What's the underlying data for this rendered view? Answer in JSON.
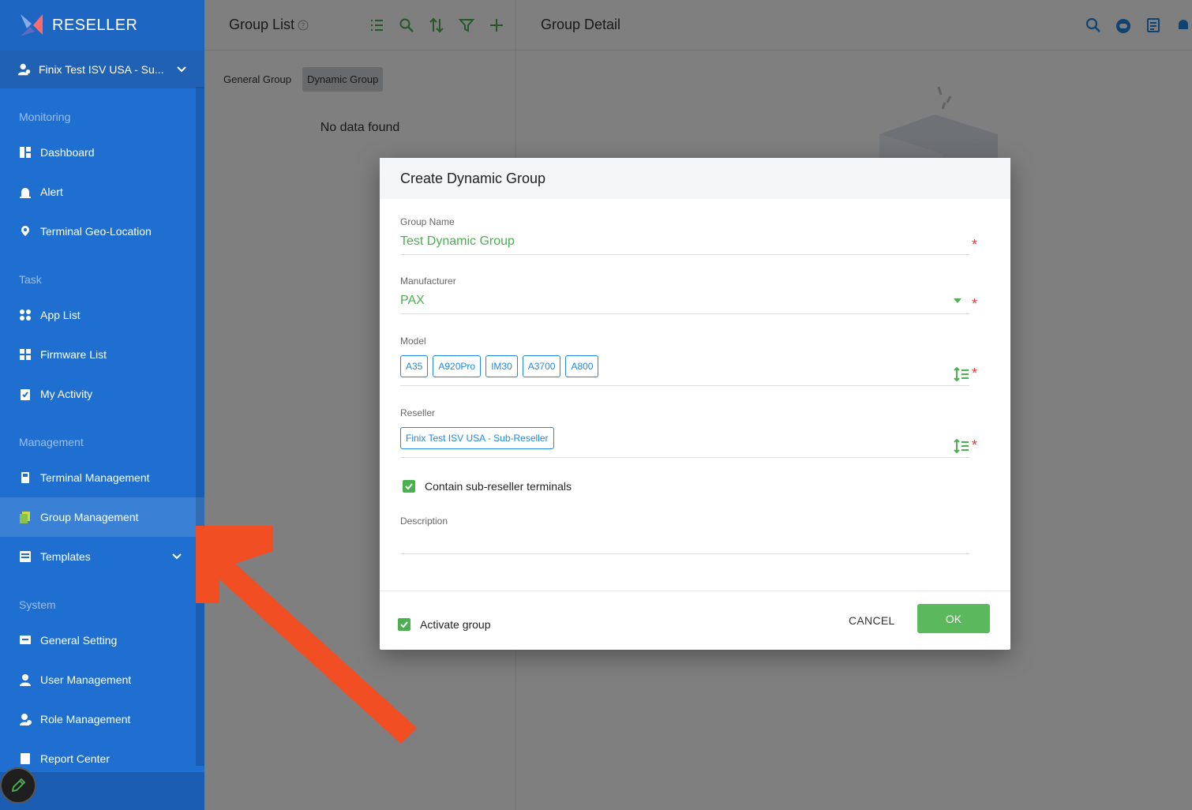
{
  "app": {
    "brand": "RESELLER"
  },
  "account": {
    "name": "Finix Test ISV USA - Su..."
  },
  "sidebar": {
    "sections": [
      {
        "title": "Monitoring",
        "items": [
          {
            "label": "Dashboard",
            "icon": "dashboard-icon"
          },
          {
            "label": "Alert",
            "icon": "alert-icon"
          },
          {
            "label": "Terminal Geo-Location",
            "icon": "location-pin-icon"
          }
        ]
      },
      {
        "title": "Task",
        "items": [
          {
            "label": "App List",
            "icon": "apps-icon"
          },
          {
            "label": "Firmware List",
            "icon": "firmware-icon"
          },
          {
            "label": "My Activity",
            "icon": "clipboard-icon"
          }
        ]
      },
      {
        "title": "Management",
        "items": [
          {
            "label": "Terminal Management",
            "icon": "terminal-icon"
          },
          {
            "label": "Group Management",
            "icon": "group-icon",
            "active": true
          },
          {
            "label": "Templates",
            "icon": "template-icon",
            "expandable": true
          }
        ]
      },
      {
        "title": "System",
        "items": [
          {
            "label": "General Setting",
            "icon": "settings-icon"
          },
          {
            "label": "User Management",
            "icon": "user-icon"
          },
          {
            "label": "Role Management",
            "icon": "role-icon"
          },
          {
            "label": "Report Center",
            "icon": "report-icon"
          }
        ]
      }
    ]
  },
  "group_list": {
    "title": "Group List",
    "tabs": [
      "General Group",
      "Dynamic Group"
    ],
    "selected_tab": "Dynamic Group",
    "empty_text": "No data found"
  },
  "group_detail": {
    "title": "Group Detail"
  },
  "dialog": {
    "title": "Create Dynamic Group",
    "group_name": {
      "label": "Group Name",
      "value": "Test Dynamic Group"
    },
    "manufacturer": {
      "label": "Manufacturer",
      "value": "PAX"
    },
    "model": {
      "label": "Model",
      "chips": [
        "A35",
        "A920Pro",
        "IM30",
        "A3700",
        "A800"
      ]
    },
    "reseller": {
      "label": "Reseller",
      "chips": [
        "Finix Test ISV USA - Sub-Reseller"
      ]
    },
    "contain_sub": {
      "label": "Contain sub-reseller terminals",
      "checked": true
    },
    "description": {
      "label": "Description",
      "value": ""
    },
    "activate": {
      "label": "Activate group",
      "checked": true
    },
    "cancel_label": "CANCEL",
    "ok_label": "OK",
    "required_mark": "*"
  },
  "colors": {
    "sidebar": "#1f6fd0",
    "accent_green": "#4caf50",
    "chip_blue": "#1e88e5",
    "required_red": "#e53935",
    "annotation_arrow": "#f24e24"
  }
}
